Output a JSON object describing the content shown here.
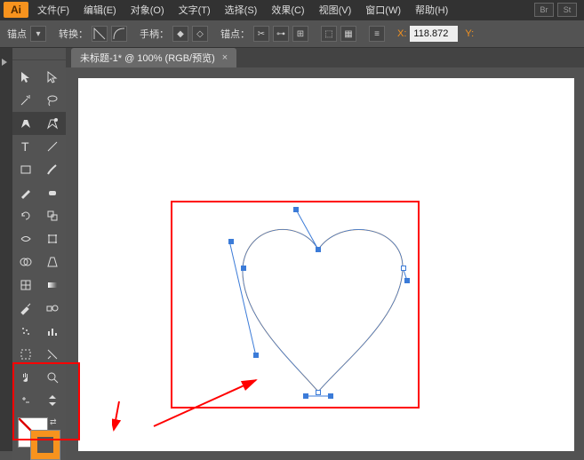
{
  "app": {
    "logo": "Ai"
  },
  "menu": {
    "items": [
      "文件(F)",
      "编辑(E)",
      "对象(O)",
      "文字(T)",
      "选择(S)",
      "效果(C)",
      "视图(V)",
      "窗口(W)",
      "帮助(H)"
    ],
    "ext": [
      "Br",
      "St"
    ]
  },
  "controlbar": {
    "anchor_label": "锚点",
    "convert_label": "转换：",
    "handle_label": "手柄：",
    "anchor2_label": "锚点：",
    "x_label": "X:",
    "x_value": "118.872",
    "y_label": "Y:"
  },
  "tab": {
    "title": "未标题-1* @ 100% (RGB/预览)",
    "close": "×"
  },
  "tools": {
    "items": [
      "selection",
      "direct-select",
      "magic-wand",
      "lasso",
      "pen",
      "pen-plus",
      "type",
      "line",
      "rectangle",
      "shape",
      "paintbrush",
      "pencil",
      "blob",
      "eraser",
      "rotate",
      "reflect",
      "scale",
      "width",
      "warp",
      "free-transform",
      "shapebuilder",
      "perspective",
      "mesh",
      "gradient",
      "eyedropper",
      "measure",
      "blend",
      "symbol",
      "graph",
      "spray",
      "artboard",
      "slice",
      "hand",
      "zoom",
      "swap",
      "cycle"
    ]
  },
  "colors": {
    "fill": "none",
    "stroke": "#f7931e"
  },
  "chart_data": null
}
